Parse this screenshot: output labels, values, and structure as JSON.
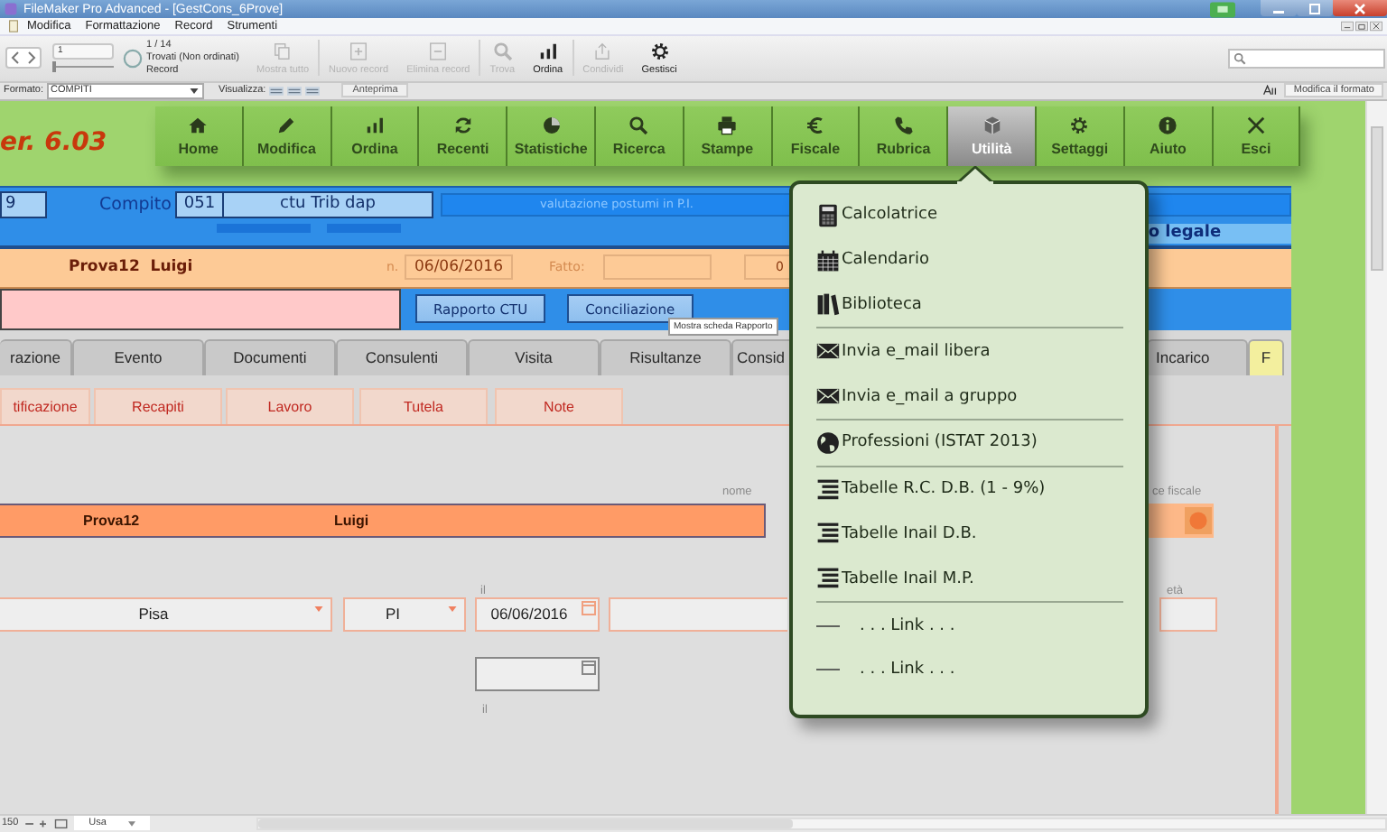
{
  "window": {
    "title": "FileMaker Pro Advanced - [GestCons_6Prove]"
  },
  "menu_bar": [
    "Modifica",
    "Formattazione",
    "Record",
    "Strumenti"
  ],
  "toolbar": {
    "record_number": "1",
    "record_slider": {
      "level": 0
    },
    "record_count": "1 / 14",
    "found_status": "Trovati (Non ordinati)",
    "record_label": "Record",
    "buttons": [
      {
        "label": "Mostra tutto",
        "kind": "copy",
        "disabled": true
      },
      {
        "label": "Nuovo record",
        "kind": "plus",
        "disabled": true
      },
      {
        "label": "Elimina record",
        "kind": "minus",
        "disabled": true
      },
      {
        "label": "Trova",
        "kind": "search",
        "disabled": true
      },
      {
        "label": "Ordina",
        "kind": "bars",
        "disabled": false
      },
      {
        "label": "Condividi",
        "kind": "share",
        "disabled": true
      },
      {
        "label": "Gestisci",
        "kind": "gear",
        "disabled": false
      }
    ]
  },
  "format_bar": {
    "format_label": "Formato:",
    "format_value": "COMPITI",
    "view_label": "Visualizza:",
    "preview_button": "Anteprima",
    "edit_button": "Modifica il formato"
  },
  "layout": {
    "version": "er. 6.03",
    "nav_buttons": [
      {
        "label": "Home",
        "kind": "home",
        "selected": false
      },
      {
        "label": "Modifica",
        "kind": "pencil",
        "selected": false
      },
      {
        "label": "Ordina",
        "kind": "bars",
        "selected": false
      },
      {
        "label": "Recenti",
        "kind": "refresh",
        "selected": false
      },
      {
        "label": "Statistiche",
        "kind": "pie",
        "selected": false
      },
      {
        "label": "Ricerca",
        "kind": "search",
        "selected": false
      },
      {
        "label": "Stampe",
        "kind": "printer",
        "selected": false
      },
      {
        "label": "Fiscale",
        "kind": "euro",
        "selected": false
      },
      {
        "label": "Rubrica",
        "kind": "phone",
        "selected": false
      },
      {
        "label": "Utilità",
        "kind": "box",
        "selected": true
      },
      {
        "label": "Settaggi",
        "kind": "gear",
        "selected": false
      },
      {
        "label": "Aiuto",
        "kind": "info",
        "selected": false
      },
      {
        "label": "Esci",
        "kind": "close",
        "selected": false
      }
    ],
    "task": {
      "id": "9",
      "label": "Compito",
      "code": "051",
      "name": "ctu Trib dap",
      "description": "valutazione postumi in P.I.",
      "type": "o legale"
    },
    "person": {
      "name": "Prova12  Luigi",
      "number_label": "n.",
      "date": "06/06/2016",
      "done_label": "Fatto:",
      "count": "0"
    },
    "report_buttons": [
      "Rapporto CTU",
      "Conciliazione"
    ],
    "tabs": [
      {
        "label": "razione",
        "color": "#c9c9c9"
      },
      {
        "label": "Evento",
        "color": "#c9c9c9"
      },
      {
        "label": "Documenti",
        "color": "#c9c9c9"
      },
      {
        "label": "Consulenti",
        "color": "#c9c9c9"
      },
      {
        "label": "Visita",
        "color": "#c9c9c9"
      },
      {
        "label": "Risultanze",
        "color": "#c9c9c9"
      },
      {
        "label": "Consid",
        "color": "#c9c9c9"
      },
      {
        "label": "Incarico",
        "color": "#c9c9c9"
      },
      {
        "label": "F",
        "color": "#f3ef9e"
      }
    ],
    "subtabs": [
      "tificazione",
      "Recapiti",
      "Lavoro",
      "Tutela",
      "Note"
    ],
    "form": {
      "name_label": "nome",
      "surname": "Prova12",
      "first_name": "Luigi",
      "tax_label": "ce fiscale",
      "birth_date_label": "il",
      "city": "Pisa",
      "province": "PI",
      "birth_date": "06/06/2016",
      "age_label": "età",
      "date2_label": "il"
    }
  },
  "tooltip": "Mostra scheda Rapporto",
  "popup_menu": {
    "groups": [
      [
        {
          "label": "Calcolatrice",
          "kind": "calculator"
        },
        {
          "label": "Calendario",
          "kind": "calendar"
        },
        {
          "label": "Biblioteca",
          "kind": "books"
        }
      ],
      [
        {
          "label": "Invia e_mail libera",
          "kind": "envelope"
        },
        {
          "label": "Invia e_mail a gruppo",
          "kind": "envelope"
        }
      ],
      [
        {
          "label": "Professioni (ISTAT 2013)",
          "kind": "globe"
        }
      ],
      [
        {
          "label": "Tabelle R.C. D.B. (1 - 9%)",
          "kind": "lines"
        },
        {
          "label": "Tabelle Inail D.B.",
          "kind": "lines"
        },
        {
          "label": "Tabelle Inail M.P.",
          "kind": "lines"
        }
      ],
      [
        {
          "label": ". . . Link . . .",
          "kind": "dash"
        },
        {
          "label": ". . . Link . . .",
          "kind": "dash"
        }
      ]
    ]
  },
  "status_bar": {
    "zoom": "150",
    "mode": "Usa"
  }
}
